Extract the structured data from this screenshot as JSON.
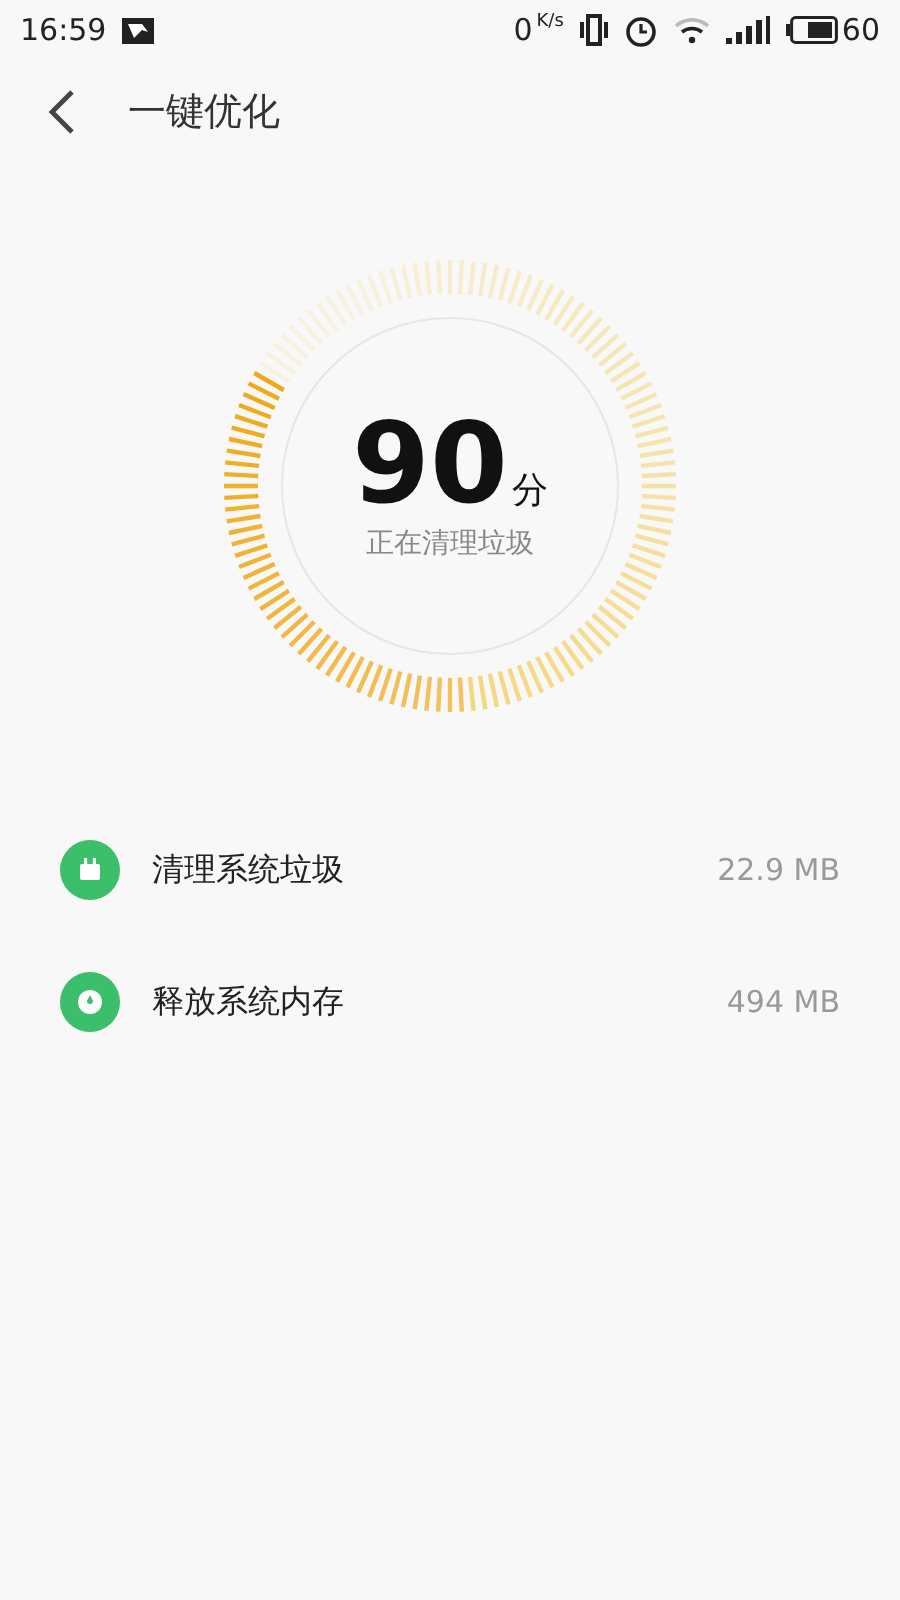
{
  "status_bar": {
    "time": "16:59",
    "speed_value": "0",
    "speed_unit": "K/s",
    "battery": "60"
  },
  "header": {
    "title": "一键优化"
  },
  "gauge": {
    "score": "90",
    "unit": "分",
    "caption": "正在清理垃圾"
  },
  "items": [
    {
      "kind": "trash",
      "label": "清理系统垃圾",
      "size": "22.9 MB"
    },
    {
      "kind": "memory",
      "label": "释放系统内存",
      "size": "494 MB"
    }
  ]
}
